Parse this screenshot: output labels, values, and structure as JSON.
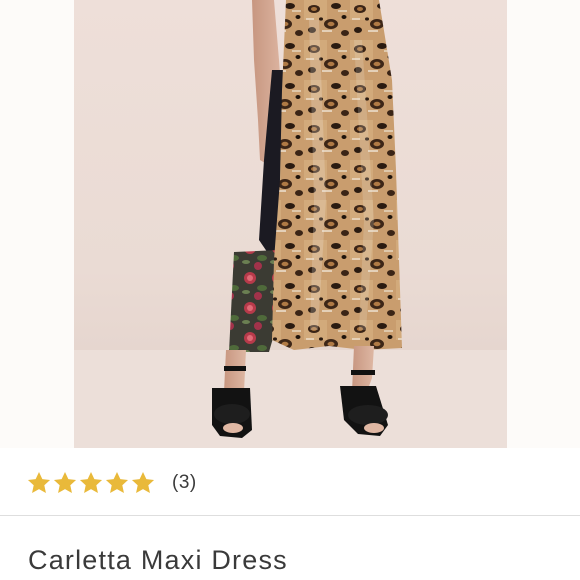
{
  "product": {
    "image_alt": "Leopard print maxi dress with black heeled sandals",
    "rating": {
      "stars_filled": 5,
      "stars_total": 5,
      "star_color": "#e9b93a",
      "review_count_label": "(3)"
    },
    "title": "Carletta Maxi Dress"
  },
  "colors": {
    "background": "#ffffff",
    "photo_background": "#eadbd4",
    "text": "#3a3a3a",
    "divider": "#dedede"
  }
}
